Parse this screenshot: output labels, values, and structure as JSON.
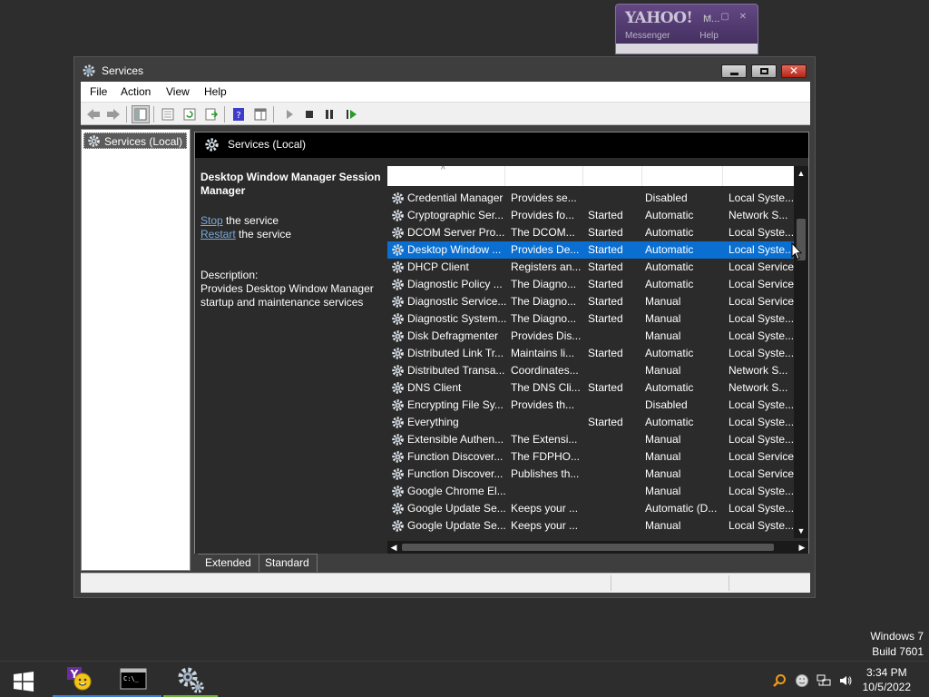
{
  "yahoo": {
    "logo": "YAHOO!",
    "title_rest": "M...",
    "menu": [
      "Messenger",
      "Help"
    ]
  },
  "window": {
    "title": "Services",
    "menu": [
      "File",
      "Action",
      "View",
      "Help"
    ]
  },
  "tree": {
    "item": "Services (Local)"
  },
  "pane": {
    "header": "Services (Local)",
    "selected_title": "Desktop Window Manager Session Manager",
    "stop_link": "Stop",
    "stop_rest": " the service",
    "restart_link": "Restart",
    "restart_rest": " the service",
    "description_label": "Description:",
    "description_text": "Provides Desktop Window Manager startup and maintenance services"
  },
  "list": {
    "sort_indicator": "^",
    "rows": [
      {
        "name": "Credential Manager",
        "desc": "Provides se...",
        "status": "",
        "startup": "Disabled",
        "logon": "Local Syste..."
      },
      {
        "name": "Cryptographic Ser...",
        "desc": "Provides fo...",
        "status": "Started",
        "startup": "Automatic",
        "logon": "Network S..."
      },
      {
        "name": "DCOM Server Pro...",
        "desc": "The DCOM...",
        "status": "Started",
        "startup": "Automatic",
        "logon": "Local Syste..."
      },
      {
        "name": "Desktop Window ...",
        "desc": "Provides De...",
        "status": "Started",
        "startup": "Automatic",
        "logon": "Local Syste...",
        "selected": true
      },
      {
        "name": "DHCP Client",
        "desc": "Registers an...",
        "status": "Started",
        "startup": "Automatic",
        "logon": "Local Service"
      },
      {
        "name": "Diagnostic Policy ...",
        "desc": "The Diagno...",
        "status": "Started",
        "startup": "Automatic",
        "logon": "Local Service"
      },
      {
        "name": "Diagnostic Service...",
        "desc": "The Diagno...",
        "status": "Started",
        "startup": "Manual",
        "logon": "Local Service"
      },
      {
        "name": "Diagnostic System...",
        "desc": "The Diagno...",
        "status": "Started",
        "startup": "Manual",
        "logon": "Local Syste..."
      },
      {
        "name": "Disk Defragmenter",
        "desc": "Provides Dis...",
        "status": "",
        "startup": "Manual",
        "logon": "Local Syste..."
      },
      {
        "name": "Distributed Link Tr...",
        "desc": "Maintains li...",
        "status": "Started",
        "startup": "Automatic",
        "logon": "Local Syste..."
      },
      {
        "name": "Distributed Transa...",
        "desc": "Coordinates...",
        "status": "",
        "startup": "Manual",
        "logon": "Network S..."
      },
      {
        "name": "DNS Client",
        "desc": "The DNS Cli...",
        "status": "Started",
        "startup": "Automatic",
        "logon": "Network S..."
      },
      {
        "name": "Encrypting File Sy...",
        "desc": "Provides th...",
        "status": "",
        "startup": "Disabled",
        "logon": "Local Syste..."
      },
      {
        "name": "Everything",
        "desc": "",
        "status": "Started",
        "startup": "Automatic",
        "logon": "Local Syste..."
      },
      {
        "name": "Extensible Authen...",
        "desc": "The Extensi...",
        "status": "",
        "startup": "Manual",
        "logon": "Local Syste..."
      },
      {
        "name": "Function Discover...",
        "desc": "The FDPHO...",
        "status": "",
        "startup": "Manual",
        "logon": "Local Service"
      },
      {
        "name": "Function Discover...",
        "desc": "Publishes th...",
        "status": "",
        "startup": "Manual",
        "logon": "Local Service"
      },
      {
        "name": "Google Chrome El...",
        "desc": "",
        "status": "",
        "startup": "Manual",
        "logon": "Local Syste..."
      },
      {
        "name": "Google Update Se...",
        "desc": "Keeps your ...",
        "status": "",
        "startup": "Automatic (D...",
        "logon": "Local Syste..."
      },
      {
        "name": "Google Update Se...",
        "desc": "Keeps your ...",
        "status": "",
        "startup": "Manual",
        "logon": "Local Syste..."
      }
    ]
  },
  "tabs": [
    "Extended",
    "Standard"
  ],
  "desktop": {
    "os_line1": "Windows 7",
    "os_line2": "Build 7601"
  },
  "clock": {
    "time": "3:34 PM",
    "date": "10/5/2022"
  },
  "taskbar": {
    "apps": [
      {
        "icon": "yahoo-messenger-icon",
        "underline": "#3d7fd6"
      },
      {
        "icon": "command-prompt-icon",
        "underline": "#3d7fd6"
      },
      {
        "icon": "services-gear-icon",
        "underline": "#6bb33a"
      }
    ]
  },
  "colors": {
    "selection": "#0a6fd1",
    "link": "#7aa9d8",
    "close_button": "#c8372a"
  }
}
